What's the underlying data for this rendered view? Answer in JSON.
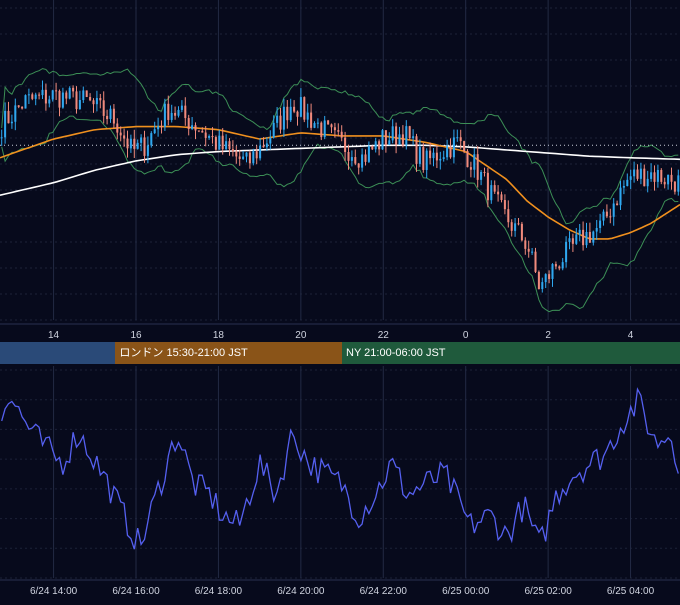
{
  "colors": {
    "background": "#070a1c",
    "grid": "#1c2238",
    "candle_up": "#2fa8f0",
    "candle_down": "#f08a7c",
    "bollinger": "#3c8f56",
    "ma_fast": "#f0901e",
    "ma_slow": "#ffffff",
    "oscillator": "#5560f0",
    "axis_text": "#d0d4e0",
    "session_tokyo": "#2a4a78",
    "session_london": "#8a5418",
    "session_ny": "#1f5a3c"
  },
  "sessions": [
    {
      "name": "",
      "color": "#2a4a78",
      "start_hour": 12.7,
      "end_hour": 15.5
    },
    {
      "name": "ロンドン 15:30-21:00 JST",
      "color": "#8a5418",
      "start_hour": 15.5,
      "end_hour": 21.0
    },
    {
      "name": "NY 21:00-06:00 JST",
      "color": "#1f5a3c",
      "start_hour": 21.0,
      "end_hour": 30.0
    }
  ],
  "chart_data": [
    {
      "type": "candlestick",
      "title": "",
      "x_range_hours": [
        12.7,
        29.2
      ],
      "y_range": [
        0,
        100
      ],
      "reference_line_y": 56,
      "grid": true,
      "x_tick_values": [
        14,
        16,
        18,
        20,
        22,
        24,
        26,
        28
      ],
      "x_tick_labels": [
        "14",
        "16",
        "18",
        "20",
        "22",
        "0",
        "2",
        "4"
      ],
      "price_anchors": {
        "hours": [
          12.7,
          13.3,
          14.0,
          14.8,
          15.5,
          15.9,
          16.2,
          16.8,
          17.5,
          18.0,
          18.7,
          19.3,
          19.8,
          20.2,
          20.8,
          21.5,
          22.0,
          22.5,
          23.0,
          23.4,
          23.8,
          24.2,
          24.8,
          25.5,
          25.8,
          26.2,
          26.8,
          27.3,
          27.6,
          28.0,
          28.5,
          29.2
        ],
        "values": [
          62,
          70,
          72,
          70,
          64,
          54,
          56,
          68,
          62,
          56,
          50,
          60,
          70,
          65,
          58,
          52,
          58,
          60,
          50,
          54,
          57,
          50,
          36,
          24,
          10,
          18,
          26,
          30,
          38,
          46,
          47,
          44
        ]
      },
      "ma_fast_anchors": {
        "hours": [
          12.7,
          14.0,
          15.0,
          16.0,
          17.0,
          18.0,
          19.0,
          20.0,
          21.0,
          22.0,
          23.0,
          24.0,
          25.0,
          25.5,
          26.0,
          26.5,
          27.0,
          27.5,
          28.0,
          28.5,
          29.2
        ],
        "values": [
          52,
          58,
          61,
          62,
          62,
          61,
          58,
          60,
          59,
          59,
          57,
          54,
          45,
          38,
          33,
          29,
          26,
          26,
          28,
          31,
          37
        ]
      },
      "ma_slow_anchors": {
        "hours": [
          12.7,
          14.0,
          15.0,
          16.0,
          17.0,
          18.0,
          19.0,
          20.0,
          21.0,
          22.0,
          23.0,
          24.0,
          25.0,
          26.0,
          27.0,
          28.0,
          29.2
        ],
        "values": [
          40,
          44,
          48,
          51,
          53,
          54,
          54.5,
          55,
          55.5,
          56,
          56,
          55.5,
          54.5,
          53.5,
          52.5,
          52,
          51.5
        ]
      }
    },
    {
      "type": "line",
      "title": "",
      "y_range": [
        0,
        100
      ],
      "grid": true,
      "x_tick_values": [
        14,
        16,
        18,
        20,
        22,
        24,
        26,
        28
      ],
      "x_tick_labels": [
        "6/24 14:00",
        "6/24 16:00",
        "6/24 18:00",
        "6/24 20:00",
        "6/24 22:00",
        "6/25 00:00",
        "6/25 02:00",
        "6/25 04:00"
      ],
      "oscillator_anchors": {
        "hours": [
          12.7,
          12.9,
          13.3,
          13.7,
          14.2,
          14.6,
          15.2,
          15.7,
          16.1,
          16.5,
          17.0,
          17.4,
          17.8,
          18.1,
          18.5,
          19.0,
          19.4,
          19.8,
          20.2,
          20.6,
          21.0,
          21.4,
          21.8,
          22.2,
          22.6,
          23.0,
          23.5,
          24.1,
          24.6,
          25.0,
          25.4,
          25.8,
          26.2,
          26.6,
          27.0,
          27.4,
          27.8,
          28.2,
          28.6,
          29.0,
          29.2
        ],
        "values": [
          75,
          90,
          75,
          65,
          55,
          70,
          50,
          30,
          15,
          40,
          70,
          45,
          40,
          30,
          25,
          55,
          40,
          70,
          55,
          50,
          45,
          30,
          40,
          55,
          40,
          45,
          50,
          25,
          30,
          20,
          35,
          15,
          40,
          50,
          55,
          60,
          75,
          85,
          65,
          70,
          50
        ]
      }
    }
  ]
}
